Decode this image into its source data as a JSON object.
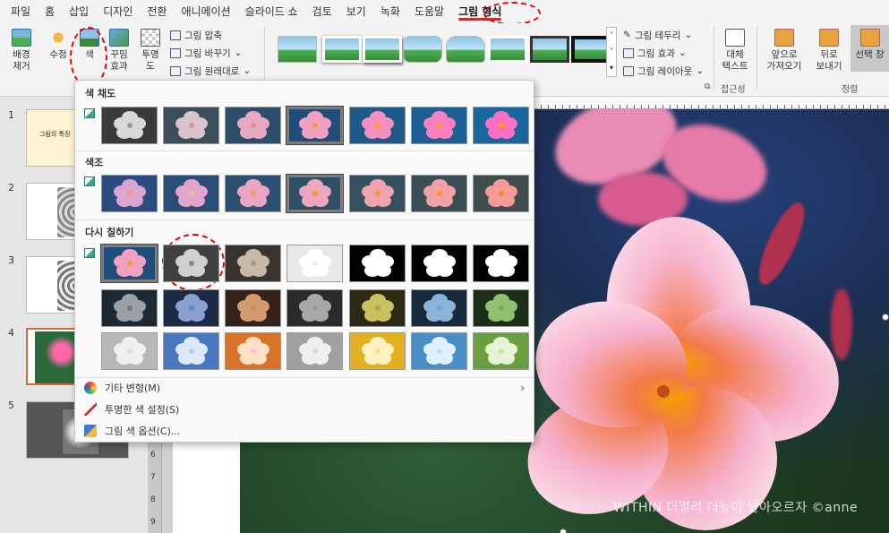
{
  "menu": {
    "items": [
      "파일",
      "홈",
      "삽입",
      "디자인",
      "전환",
      "애니메이션",
      "슬라이드 쇼",
      "검토",
      "보기",
      "녹화",
      "도움말",
      "그림 형식"
    ],
    "active_index": 11
  },
  "ribbon": {
    "remove_bg": "배경\n제거",
    "correct": "수정",
    "color": "색",
    "artistic": "꾸밈\n효과",
    "transparency": "투명\n도",
    "compress": "그림 압축",
    "change": "그림 바꾸기",
    "reset": "그림 원래대로",
    "border": "그림 테두리",
    "effects": "그림 효과",
    "layout": "그림 레이아웃",
    "alt_text": "대체\n텍스트",
    "accessibility_group": "접근성",
    "bring_forward": "앞으로\n가져오기",
    "send_backward": "뒤로\n보내기",
    "selection_pane": "선택 창",
    "arrange_group": "정렬"
  },
  "thumbnails": [
    {
      "num": "1",
      "text": "그림의 특징"
    },
    {
      "num": "2",
      "text": ""
    },
    {
      "num": "3",
      "text": ""
    },
    {
      "num": "4",
      "text": ""
    },
    {
      "num": "5",
      "text": ""
    }
  ],
  "ruler_marks": [
    "6",
    "7",
    "8",
    "9"
  ],
  "color_panel": {
    "saturation_title": "색 채도",
    "tone_title": "색조",
    "recolor_title": "다시 칠하기",
    "more_variations": "기타 변형(M)",
    "set_transparent": "투명한 색 설정(S)",
    "color_options": "그림 색 옵션(C)..."
  },
  "watermark": "WITHIN 더멀리 더높이 날아오르자 ©anne",
  "colors": {
    "accent": "#b7472a",
    "highlight": "#e00000"
  }
}
